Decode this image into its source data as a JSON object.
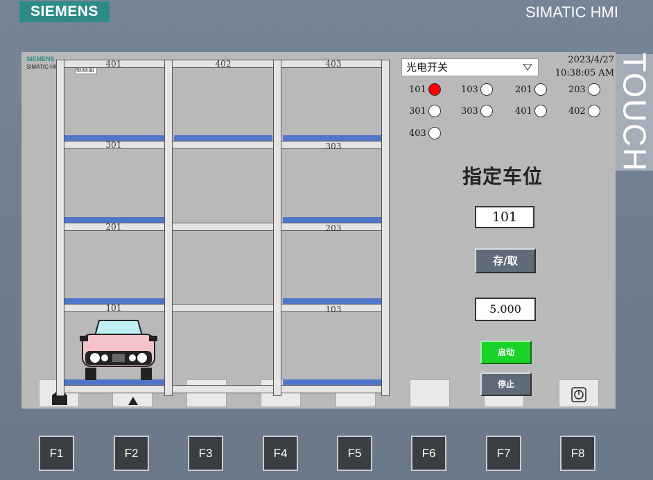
{
  "bezel": {
    "brand": "SIEMENS",
    "product": "SIMATIC HMI",
    "side_label": "TOUCH"
  },
  "screen": {
    "mini_brand": "SIEMENS",
    "mini_sub": "SIMATIC HMI",
    "mini_title": "根画面",
    "garage": {
      "top_labels": [
        "401",
        "402",
        "403"
      ],
      "row3_labels": [
        "301",
        "303"
      ],
      "row2_labels": [
        "201",
        "203"
      ],
      "row1_labels": [
        "101",
        "103"
      ]
    },
    "selector": {
      "value": "光电开关"
    },
    "datetime": {
      "date": "2023/4/27",
      "time": "10:38:05 AM"
    },
    "sensors": [
      {
        "label": "101",
        "on": true
      },
      {
        "label": "103",
        "on": false
      },
      {
        "label": "201",
        "on": false
      },
      {
        "label": "203",
        "on": false
      },
      {
        "label": "301",
        "on": false
      },
      {
        "label": "303",
        "on": false
      },
      {
        "label": "401",
        "on": false
      },
      {
        "label": "402",
        "on": false
      },
      {
        "label": "403",
        "on": false
      }
    ],
    "heading": "指定车位",
    "slot_value": "101",
    "store_button": "存/取",
    "speed_value": "5.000",
    "start_button": "启动",
    "stop_button": "停止"
  },
  "function_keys": [
    "F1",
    "F2",
    "F3",
    "F4",
    "F5",
    "F6",
    "F7",
    "F8"
  ],
  "colors": {
    "sensor_on": "#ff0000",
    "platform": "#4f76c9",
    "start": "#19d326",
    "brand": "#2e8c87"
  }
}
